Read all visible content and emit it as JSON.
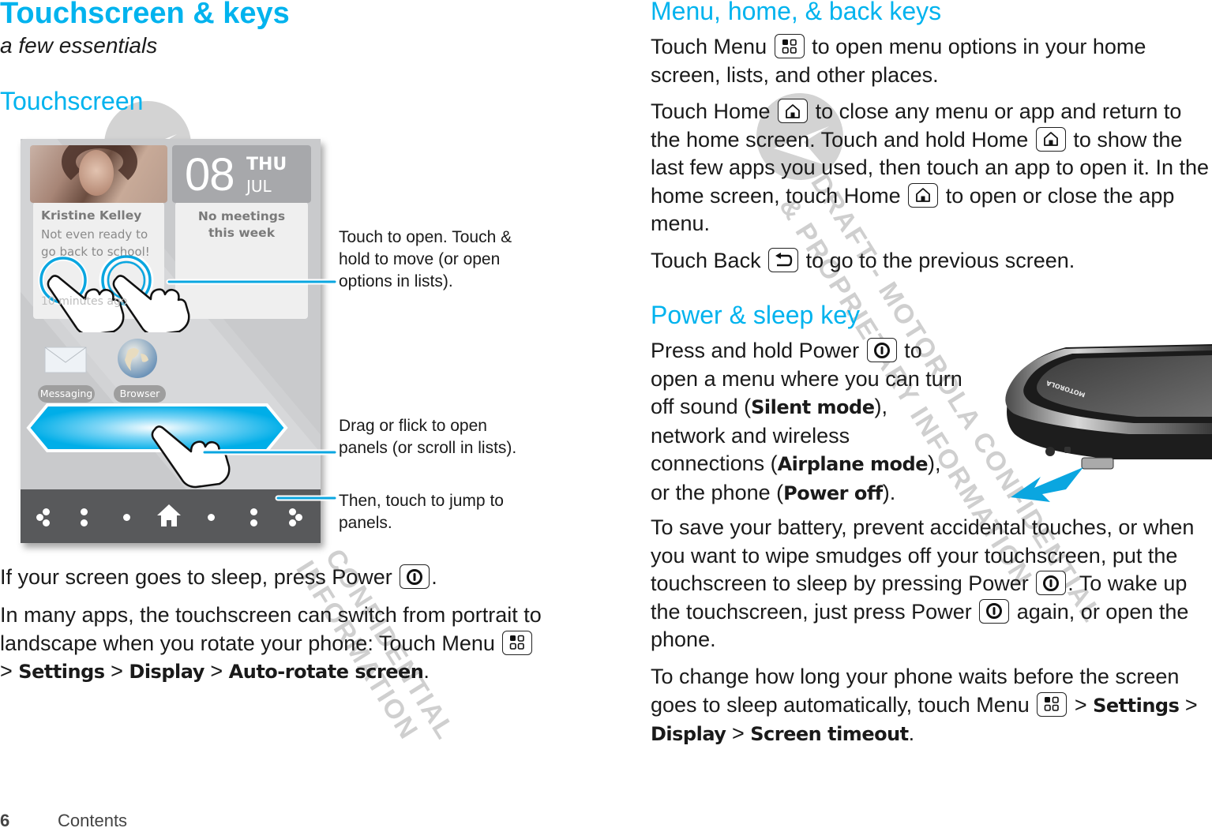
{
  "page": {
    "number": "6",
    "section_label": "Contents"
  },
  "left": {
    "chapter_title": "Touchscreen & keys",
    "chapter_subtitle": "a few essentials",
    "section_title": "Touchscreen",
    "phone_screen": {
      "contact_name": "Kristine Kelley",
      "contact_message_line1": "Not even ready to",
      "contact_message_line2": "go back to school!",
      "contact_time": "10 minutes ago",
      "date_number": "08",
      "date_day": "THU",
      "date_month": "JUL",
      "calendar_text_line1": "No meetings",
      "calendar_text_line2": "this week",
      "apps": [
        {
          "label": "Messaging",
          "icon": "envelope-icon"
        },
        {
          "label": "Browser",
          "icon": "globe-icon"
        }
      ],
      "nav_icon": "home-icon"
    },
    "callouts": [
      "Touch to open. Touch & hold to move (or open options in lists).",
      "Drag or flick to open panels (or scroll in lists).",
      "Then, touch to jump to panels."
    ],
    "para_sleep": {
      "before": "If your screen goes to sleep, press Power",
      "after": "."
    },
    "para_rotate": {
      "line": "In many apps, the touchscreen can switch from portrait to landscape when you rotate your phone: Touch Menu",
      "sep": ">",
      "path": [
        "Settings",
        "Display",
        "Auto-rotate screen"
      ],
      "end": "."
    }
  },
  "right": {
    "section1_title": "Menu, home, & back keys",
    "menu_para": {
      "before": "Touch Menu",
      "after": "to open menu options in your home screen, lists, and other places."
    },
    "home_para": {
      "p1": "Touch Home",
      "p2": "to close any menu or app and return to the home screen. Touch and hold Home",
      "p3": "to show the last few apps you used, then touch an app to open it. In the home screen, touch Home",
      "p4": "to open or close the app menu."
    },
    "back_para": {
      "before": "Touch Back",
      "after": "to go to the previous screen."
    },
    "section2_title": "Power & sleep key",
    "power_para": {
      "p1": "Press and hold Power",
      "p2": "to open a menu where you can turn off sound (",
      "b1": "Silent mode",
      "p3": "), network and wireless connections (",
      "b2": "Airplane mode",
      "p4": "), or the phone (",
      "b3": "Power off",
      "p5": ")."
    },
    "battery_para": {
      "p1": "To save your battery, prevent accidental touches, or when you want to wipe smudges off your touchscreen, put the touchscreen to sleep by pressing Power",
      "p2": ". To wake up the touchscreen, just press Power",
      "p3": "again, or open the phone."
    },
    "timeout_para": {
      "p1": "To change how long your phone waits before the screen goes to sleep automatically, touch Menu",
      "sep": ">",
      "path": [
        "Settings",
        "Display",
        "Screen timeout"
      ],
      "end": "."
    },
    "device_brand": "MOTOROLA"
  },
  "watermarks": [
    "DRAFT - MOTOROLA CONFIDENTIAL",
    "& PROPRIETARY INFORMATION",
    "CONFIDENTIAL",
    "INFORMATION"
  ],
  "colors": {
    "accent": "#00b3ee",
    "body_text": "#1a1a1a",
    "watermark": "#cfcfcf",
    "navbar": "#58595b"
  }
}
